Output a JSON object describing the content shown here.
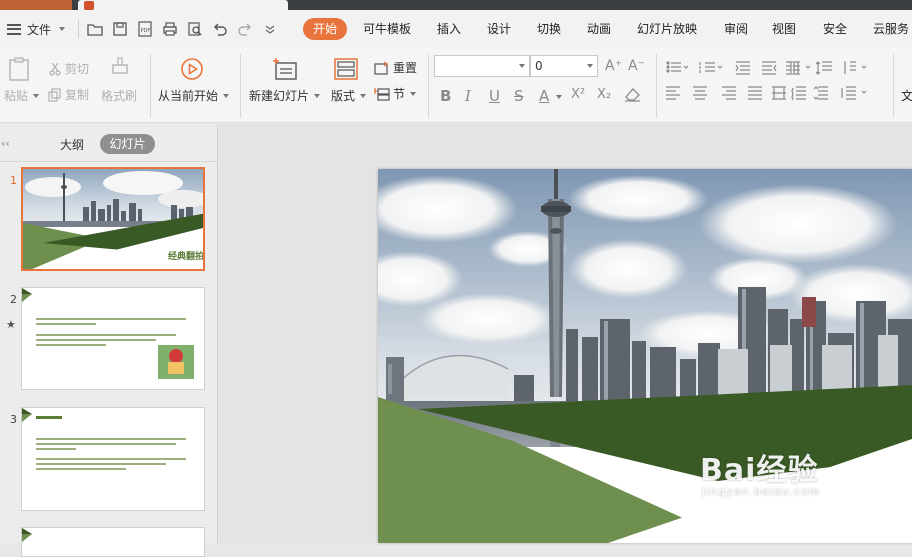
{
  "menubar": {
    "file_label": "文件",
    "tabs": [
      "开始",
      "可牛模板",
      "插入",
      "设计",
      "切换",
      "动画",
      "幻灯片放映",
      "审阅",
      "视图",
      "安全",
      "云服务"
    ]
  },
  "ribbon": {
    "paste": "粘贴",
    "cut": "剪切",
    "copy": "复制",
    "format_painter": "格式刷",
    "from_current": "从当前开始",
    "new_slide": "新建幻灯片",
    "layout": "版式",
    "reset": "重置",
    "section": "节",
    "font_name": "",
    "font_size": "0",
    "text_cut": "文"
  },
  "leftpanel": {
    "outline": "大纲",
    "slides": "幻灯片",
    "slide_numbers": [
      "1",
      "2",
      "3"
    ],
    "thumb1_title": "经典翻拍"
  },
  "watermark": {
    "brand": "Bai经验",
    "url": "jingyan.baidu.com"
  },
  "colors": {
    "accent": "#e8743b",
    "slide_green_light": "#6f8f4e",
    "slide_green_dark": "#3a5a25"
  }
}
